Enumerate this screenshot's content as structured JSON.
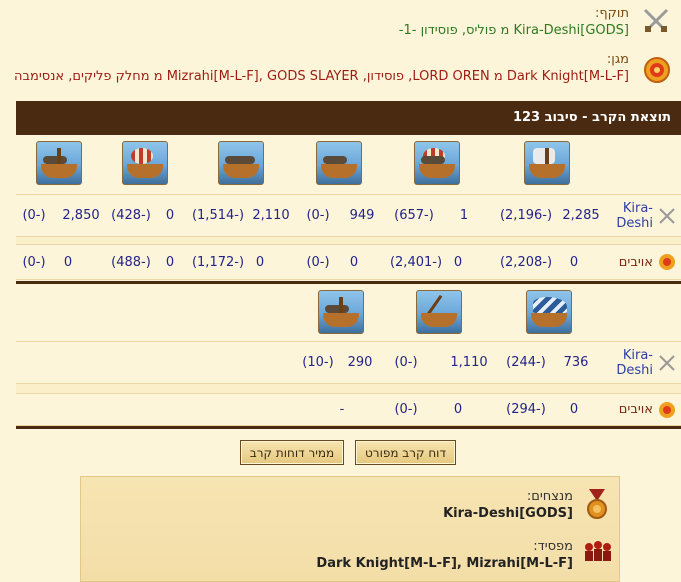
{
  "attacker": {
    "label": "תוקף:",
    "text": "Kira-Deshi[GODS] מ פוליס, פוסידון -1-",
    "icon": "crossed-swords-icon"
  },
  "defender": {
    "label": "מגן:",
    "text": "Dark Knight[M-L-F] מ LORD OREN, פוסידון, Mizrahi[M-L-F], GODS SLAYER מ מחלק פליקים, אנסימבה",
    "icon": "target-shield-icon"
  },
  "banner": {
    "title": "תוצאת הקרב - סיבוב 123"
  },
  "table1": {
    "ships": [
      "ship-1",
      "ship-2",
      "ship-3",
      "ship-4",
      "ship-5",
      "ship-6"
    ],
    "rows": [
      {
        "label": "Kira-Deshi",
        "values": [
          {
            "count": "2,285",
            "loss": "(2,196-)"
          },
          {
            "count": "1",
            "loss": "(657-)"
          },
          {
            "count": "949",
            "loss": "(0-)"
          },
          {
            "count": "2,110",
            "loss": "(1,514-)"
          },
          {
            "count": "0",
            "loss": "(428-)"
          },
          {
            "count": "2,850",
            "loss": "(0-)"
          }
        ]
      },
      {
        "label": "אויבים",
        "values": [
          {
            "count": "0",
            "loss": "(2,208-)"
          },
          {
            "count": "0",
            "loss": "(2,401-)"
          },
          {
            "count": "0",
            "loss": "(0-)"
          },
          {
            "count": "0",
            "loss": "(1,172-)"
          },
          {
            "count": "0",
            "loss": "(488-)"
          },
          {
            "count": "0",
            "loss": "(0-)"
          }
        ]
      }
    ]
  },
  "table2": {
    "rows": [
      {
        "label": "Kira-Deshi",
        "values": [
          {
            "count": "736",
            "loss": "(244-)"
          },
          {
            "count": "1,110",
            "loss": "(0-)"
          },
          {
            "count": "290",
            "loss": "(10-)"
          }
        ]
      },
      {
        "label": "אויבים",
        "values": [
          {
            "count": "0",
            "loss": "(294-)"
          },
          {
            "count": "0",
            "loss": "(0-)"
          },
          {
            "count": "",
            "loss": "-"
          }
        ]
      }
    ]
  },
  "buttons": {
    "detailed": "דוח קרב מפורט",
    "converter": "ממיר דוחות קרב"
  },
  "summary": {
    "winners_label": "מנצחים:",
    "winners": "Kira-Deshi[GODS]",
    "losers_label": "מפסיד:",
    "losers": "Dark Knight[M-L-F], Mizrahi[M-L-F]"
  },
  "colors": {
    "banner_bg": "#4a2a10",
    "attacker_text": "#2d7a1d",
    "defender_text": "#9c1c12",
    "page_bg": "#fdf5da"
  }
}
